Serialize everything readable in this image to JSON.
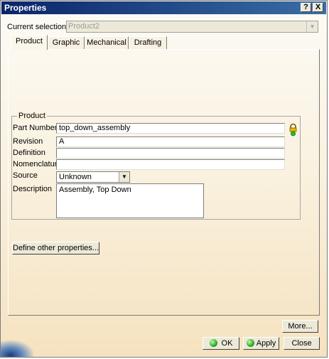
{
  "window": {
    "title": "Properties"
  },
  "title_buttons": {
    "help": "?",
    "close": "X"
  },
  "selection": {
    "label": "Current selection :",
    "value": "Product2"
  },
  "tabs": [
    {
      "label": "Product",
      "active": true
    },
    {
      "label": "Graphic",
      "active": false
    },
    {
      "label": "Mechanical",
      "active": false
    },
    {
      "label": "Drafting",
      "active": false
    }
  ],
  "product_group": {
    "title": "Product",
    "part_number": {
      "label": "Part Number",
      "value": "top_down_assembly"
    },
    "revision": {
      "label": "Revision",
      "value": "A"
    },
    "definition": {
      "label": "Definition",
      "value": ""
    },
    "nomenclature": {
      "label": "Nomenclature",
      "value": ""
    },
    "source": {
      "label": "Source",
      "value": "Unknown"
    },
    "description": {
      "label": "Description",
      "value": "Assembly, Top Down"
    }
  },
  "define_other_label": "Define other properties...",
  "buttons": {
    "more": "More...",
    "ok": "OK",
    "apply": "Apply",
    "close": "Close"
  },
  "icons": {
    "lock": "lock-icon",
    "ok": "green-dot-icon",
    "apply": "green-dot-icon"
  }
}
